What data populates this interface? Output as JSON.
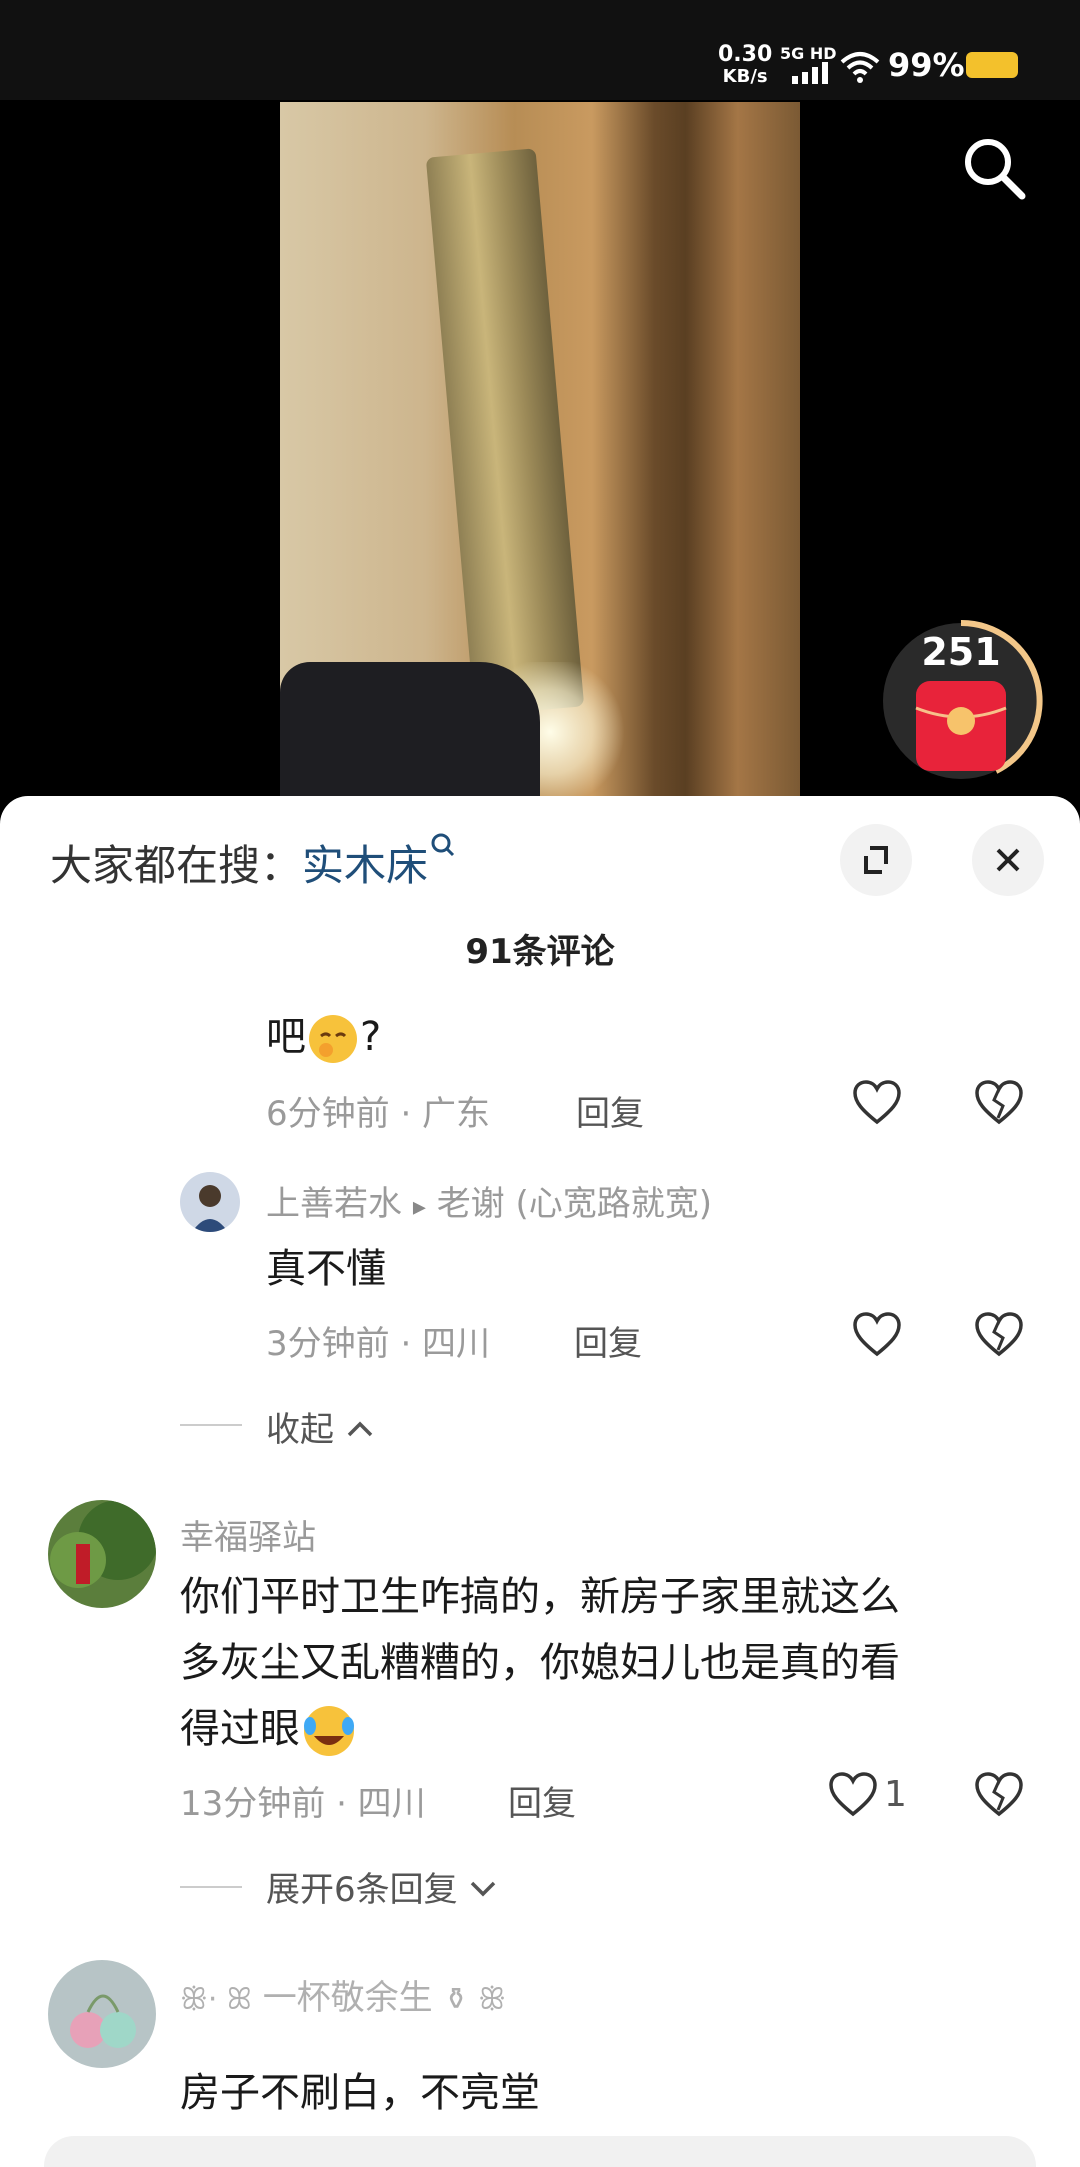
{
  "status_bar": {
    "left_text": "",
    "net_speed_value": "0.30",
    "net_speed_unit": "KB/s",
    "network": "5G HD",
    "battery": "99%",
    "battery_color": "#f3c12c"
  },
  "video": {
    "red_packet_count": "251"
  },
  "comments_panel": {
    "search_prefix": "大家都在搜：",
    "search_keyword": "实木床",
    "count_title": "91条评论",
    "partial_comment": {
      "text": "吧",
      "suffix": "?",
      "time": "6分钟前 · 广东",
      "reply": "回复"
    },
    "sub_reply": {
      "user": "上善若水",
      "arrow": "▸",
      "reply_to": "老谢 (心宽路就宽)",
      "text": "真不懂",
      "time": "3分钟前 · 四川",
      "reply": "回复"
    },
    "collapse_label": "收起",
    "comment_1": {
      "user": "幸福驿站",
      "line1": "你们平时卫生咋搞的，新房子家里就这么",
      "line2": "多灰尘又乱糟糟的，你媳妇儿也是真的看",
      "line3": "得过眼",
      "time": "13分钟前 · 四川",
      "reply": "回复",
      "likes": "1"
    },
    "expand_label": "展开6条回复",
    "comment_2": {
      "user": "一杯敬余生",
      "text": "房子不刷白，不亮堂"
    }
  }
}
